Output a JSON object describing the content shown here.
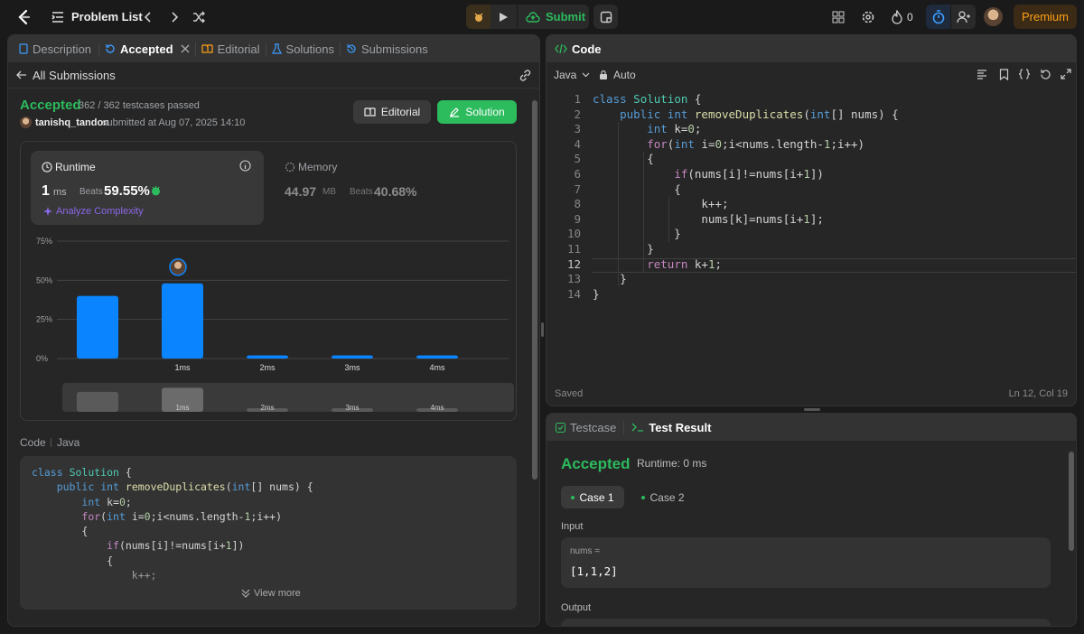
{
  "topbar": {
    "problem_list": "Problem List",
    "submit": "Submit",
    "streak": "0",
    "premium": "Premium"
  },
  "left": {
    "tabs": [
      {
        "label": "Description"
      },
      {
        "label": "Accepted"
      },
      {
        "label": "Editorial"
      },
      {
        "label": "Solutions"
      },
      {
        "label": "Submissions"
      }
    ],
    "all_submissions": "All Submissions",
    "status": "Accepted",
    "testcases": "362 / 362 testcases passed",
    "user": "tanishq_tandon",
    "submitted": "submitted at Aug 07, 2025 14:10",
    "editorial_btn": "Editorial",
    "solution_btn": "Solution",
    "runtime": {
      "title": "Runtime",
      "value": "1",
      "unit": "ms",
      "beats_label": "Beats",
      "beats": "59.55%",
      "analyze": "Analyze Complexity"
    },
    "memory": {
      "title": "Memory",
      "value": "44.97",
      "unit": "MB",
      "beats_label": "Beats",
      "beats": "40.68%"
    },
    "code_label": "Code",
    "lang_label": "Java",
    "view_more": "View more",
    "code_lines": [
      "class Solution {",
      "    public int removeDuplicates(int[] nums) {",
      "        int k=0;",
      "        for(int i=0;i<nums.length-1;i++)",
      "        {",
      "            if(nums[i]!=nums[i+1])",
      "            {",
      "                k++;"
    ]
  },
  "chart_data": {
    "type": "bar",
    "categories": [
      "",
      "1ms",
      "2ms",
      "3ms",
      "4ms"
    ],
    "values": [
      40,
      48,
      2,
      2,
      2
    ],
    "ylim": [
      0,
      75
    ],
    "yticks": [
      "75%",
      "50%",
      "25%",
      "0%"
    ],
    "highlight_index": 1,
    "grid": true,
    "bar_color": "#0a84ff",
    "mini_categories": [
      "",
      "1ms",
      "2ms",
      "3ms",
      "4ms"
    ]
  },
  "editor": {
    "tab": "Code",
    "lang": "Java",
    "auto": "Auto",
    "saved": "Saved",
    "cursor": "Ln 12, Col 19",
    "line_numbers": [
      "1",
      "2",
      "3",
      "4",
      "5",
      "6",
      "7",
      "8",
      "9",
      "10",
      "11",
      "12",
      "13",
      "14"
    ],
    "lines": [
      "class Solution {",
      "    public int removeDuplicates(int[] nums) {",
      "        int k=0;",
      "        for(int i=0;i<nums.length-1;i++)",
      "        {",
      "            if(nums[i]!=nums[i+1])",
      "            {",
      "                k++;",
      "                nums[k]=nums[i+1];",
      "            }",
      "        }",
      "        return k+1;",
      "    }",
      "}"
    ]
  },
  "result": {
    "tabs": [
      {
        "label": "Testcase"
      },
      {
        "label": "Test Result"
      }
    ],
    "status": "Accepted",
    "runtime": "Runtime: 0 ms",
    "cases": [
      {
        "label": "Case 1"
      },
      {
        "label": "Case 2"
      }
    ],
    "input_label": "Input",
    "var_name": "nums =",
    "var_value": "[1,1,2]",
    "output_label": "Output"
  },
  "colors": {
    "accent_green": "#2cbb5d",
    "accent_blue": "#0a84ff",
    "premium": "#ffa116"
  }
}
